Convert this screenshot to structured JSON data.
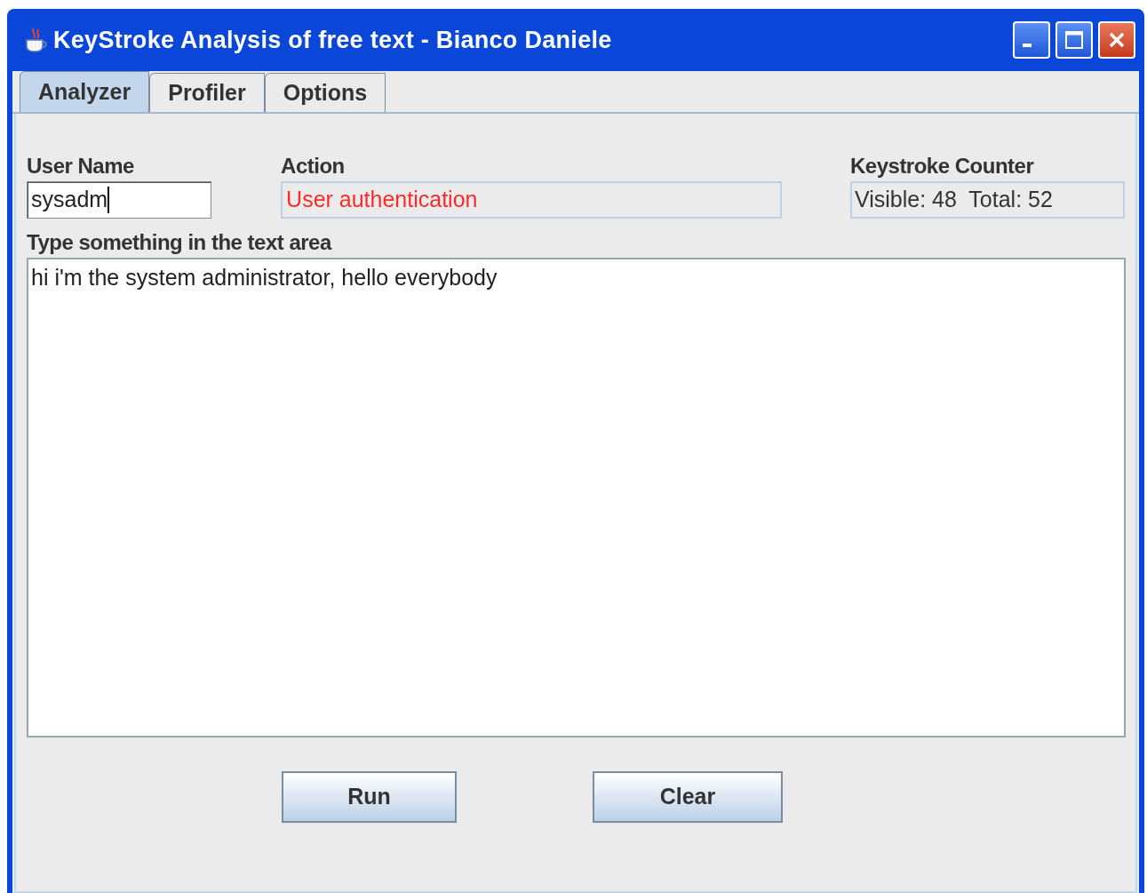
{
  "window": {
    "title": "KeyStroke Analysis of free text - Bianco Daniele"
  },
  "tabs": [
    {
      "label": "Analyzer",
      "selected": true
    },
    {
      "label": "Profiler",
      "selected": false
    },
    {
      "label": "Options",
      "selected": false
    }
  ],
  "user_name": {
    "label": "User Name",
    "value": "sysadm",
    "focused": true
  },
  "action": {
    "label": "Action",
    "value": "User authentication"
  },
  "keystroke_counter": {
    "label": "Keystroke Counter",
    "value": "Visible: 48  Total: 52"
  },
  "text_area": {
    "label": "Type something in the text area",
    "value": "hi i'm the system administrator, hello everybody"
  },
  "buttons": [
    "Run",
    "Clear"
  ]
}
